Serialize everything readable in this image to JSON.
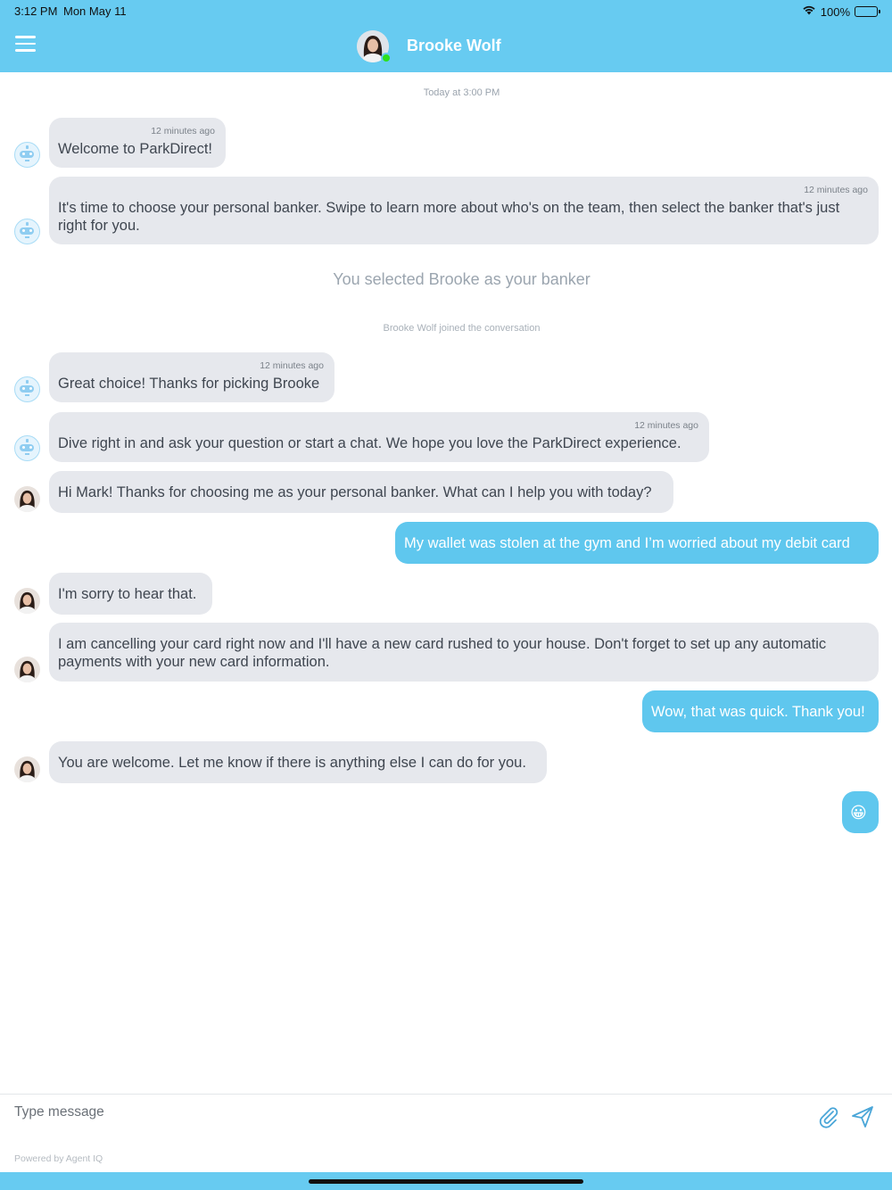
{
  "status_bar": {
    "time": "3:12 PM",
    "date": "Mon May 11",
    "battery_pct": "100%",
    "wifi_icon": "wifi-icon",
    "battery_icon": "battery-icon"
  },
  "header": {
    "contact_name": "Brooke Wolf",
    "contact_online": true,
    "menu_icon": "hamburger-menu-icon",
    "background_color": "#67cbf1",
    "online_color": "#2ce01c"
  },
  "conversation": {
    "date_stamp": "Today at 3:00 PM",
    "selection_notice": "You selected Brooke as your banker",
    "join_notice": "Brooke Wolf joined the conversation",
    "messages": [
      {
        "sender": "bot",
        "time": "12 minutes ago",
        "text": "Welcome to ParkDirect!"
      },
      {
        "sender": "bot",
        "time": "12 minutes ago",
        "text": "It's time to choose your personal banker. Swipe to learn more about who's on the team, then select the banker that's just right for you."
      },
      {
        "sender": "bot",
        "time": "12 minutes ago",
        "text": "Great choice! Thanks for picking Brooke"
      },
      {
        "sender": "bot",
        "time": "12 minutes ago",
        "text": "Dive right in and ask your question or start a chat. We hope you love the ParkDirect experience."
      },
      {
        "sender": "agent",
        "text": "Hi Mark! Thanks for choosing me as your personal banker. What can I help you with today?"
      },
      {
        "sender": "user",
        "text": "My wallet was stolen at the gym and I’m worried about my debit card"
      },
      {
        "sender": "agent",
        "text": "I'm sorry to hear that."
      },
      {
        "sender": "agent",
        "text": "I am cancelling your card right now and I'll have a new card rushed to your house. Don't forget to set up any automatic payments with your new card information."
      },
      {
        "sender": "user",
        "text": "Wow, that was quick. Thank you!"
      },
      {
        "sender": "agent",
        "text": "You are welcome. Let me know if there is anything else I can do for you."
      },
      {
        "sender": "user",
        "text": "😀"
      }
    ],
    "incoming_bubble_color": "#e6e8ed",
    "outgoing_bubble_color": "#5fc7ee"
  },
  "composer": {
    "placeholder": "Type message",
    "attach_icon": "paperclip-icon",
    "send_icon": "send-paper-plane-icon",
    "powered_by": "Powered by Agent IQ"
  }
}
